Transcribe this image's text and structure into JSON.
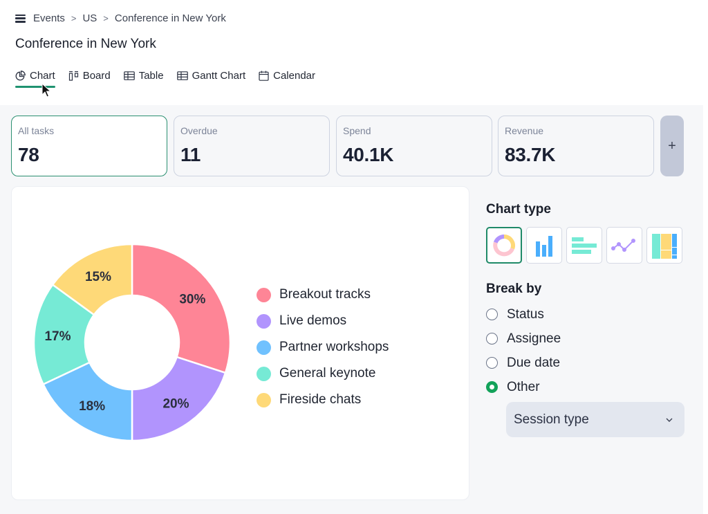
{
  "breadcrumb": {
    "items": [
      "Events",
      "US",
      "Conference in New York"
    ],
    "separator": ">"
  },
  "page_title": "Conference in New York",
  "tabs": [
    {
      "label": "Chart",
      "icon": "pie-chart-icon",
      "active": true
    },
    {
      "label": "Board",
      "icon": "board-icon",
      "active": false
    },
    {
      "label": "Table",
      "icon": "table-icon",
      "active": false
    },
    {
      "label": "Gantt Chart",
      "icon": "gantt-icon",
      "active": false
    },
    {
      "label": "Calendar",
      "icon": "calendar-icon",
      "active": false
    }
  ],
  "stats": [
    {
      "label": "All tasks",
      "value": "78",
      "active": true
    },
    {
      "label": "Overdue",
      "value": "11",
      "active": false
    },
    {
      "label": "Spend",
      "value": "40.1K",
      "active": false
    },
    {
      "label": "Revenue",
      "value": "83.7K",
      "active": false
    }
  ],
  "add_stat_label": "+",
  "colors": {
    "accent": "#1f9270",
    "radio_checked": "#13a25a"
  },
  "chart_data": {
    "type": "pie",
    "variant": "donut",
    "categories": [
      "Breakout tracks",
      "Live demos",
      "Partner workshops",
      "General keynote",
      "Fireside chats"
    ],
    "values": [
      30,
      20,
      18,
      17,
      15
    ],
    "labels": [
      "30%",
      "20%",
      "18%",
      "17%",
      "15%"
    ],
    "colors": [
      "#fe8596",
      "#b194fd",
      "#70c1fe",
      "#76ead5",
      "#fed978"
    ],
    "unit": "%",
    "legend_position": "right",
    "start_angle": "top",
    "direction": "clockwise"
  },
  "side": {
    "chart_type_title": "Chart type",
    "chart_types": [
      {
        "name": "donut",
        "active": true
      },
      {
        "name": "column",
        "active": false
      },
      {
        "name": "bar",
        "active": false
      },
      {
        "name": "line",
        "active": false
      },
      {
        "name": "treemap",
        "active": false
      }
    ],
    "break_by_title": "Break by",
    "break_by_options": [
      {
        "label": "Status",
        "checked": false
      },
      {
        "label": "Assignee",
        "checked": false
      },
      {
        "label": "Due date",
        "checked": false
      },
      {
        "label": "Other",
        "checked": true
      }
    ],
    "other_select_value": "Session type"
  }
}
